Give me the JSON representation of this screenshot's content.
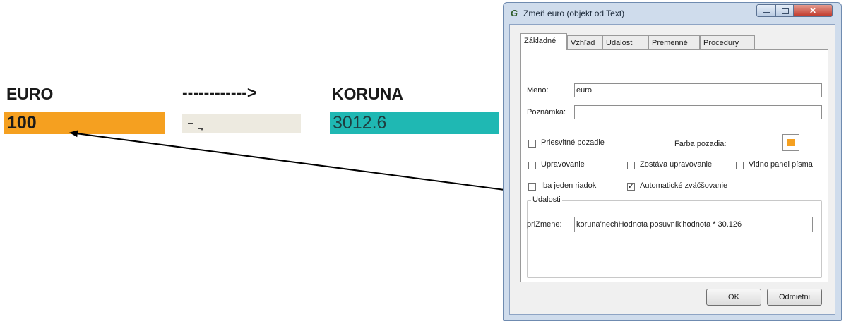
{
  "labels": {
    "euro": "EURO",
    "arrow": "------------>",
    "koruna": "KORUNA"
  },
  "values": {
    "euro": "100",
    "koruna": "3012.6"
  },
  "slider": {
    "value_fraction": 0.1
  },
  "colors": {
    "euro_box": "#f5a020",
    "koruna_box": "#1fb8b3",
    "background_swatch": "#f5a020"
  },
  "dialog": {
    "title": "Zmeň euro (objekt od Text)",
    "icon": "app-icon",
    "tabs": [
      "Základné",
      "Vzhľad",
      "Udalosti",
      "Premenné",
      "Procedúry"
    ],
    "active_tab": "Základné",
    "meno_label": "Meno:",
    "meno_value": "euro",
    "poznamka_label": "Poznámka:",
    "poznamka_value": "",
    "priesvitne_label": "Priesvitné pozadie",
    "farba_label": "Farba pozadia:",
    "upravovanie_label": "Upravovanie",
    "zostava_label": "Zostáva upravovanie",
    "vidno_label": "Vidno panel písma",
    "iba_label": "Iba jeden riadok",
    "auto_label": "Automatické zväčšovanie",
    "auto_checked": true,
    "udalosti_title": "Udalosti",
    "prizmene_label": "priZmene:",
    "prizmene_value": "koruna'nechHodnota posuvník'hodnota * 30.126",
    "ok_label": "OK",
    "cancel_label": "Odmietni"
  }
}
